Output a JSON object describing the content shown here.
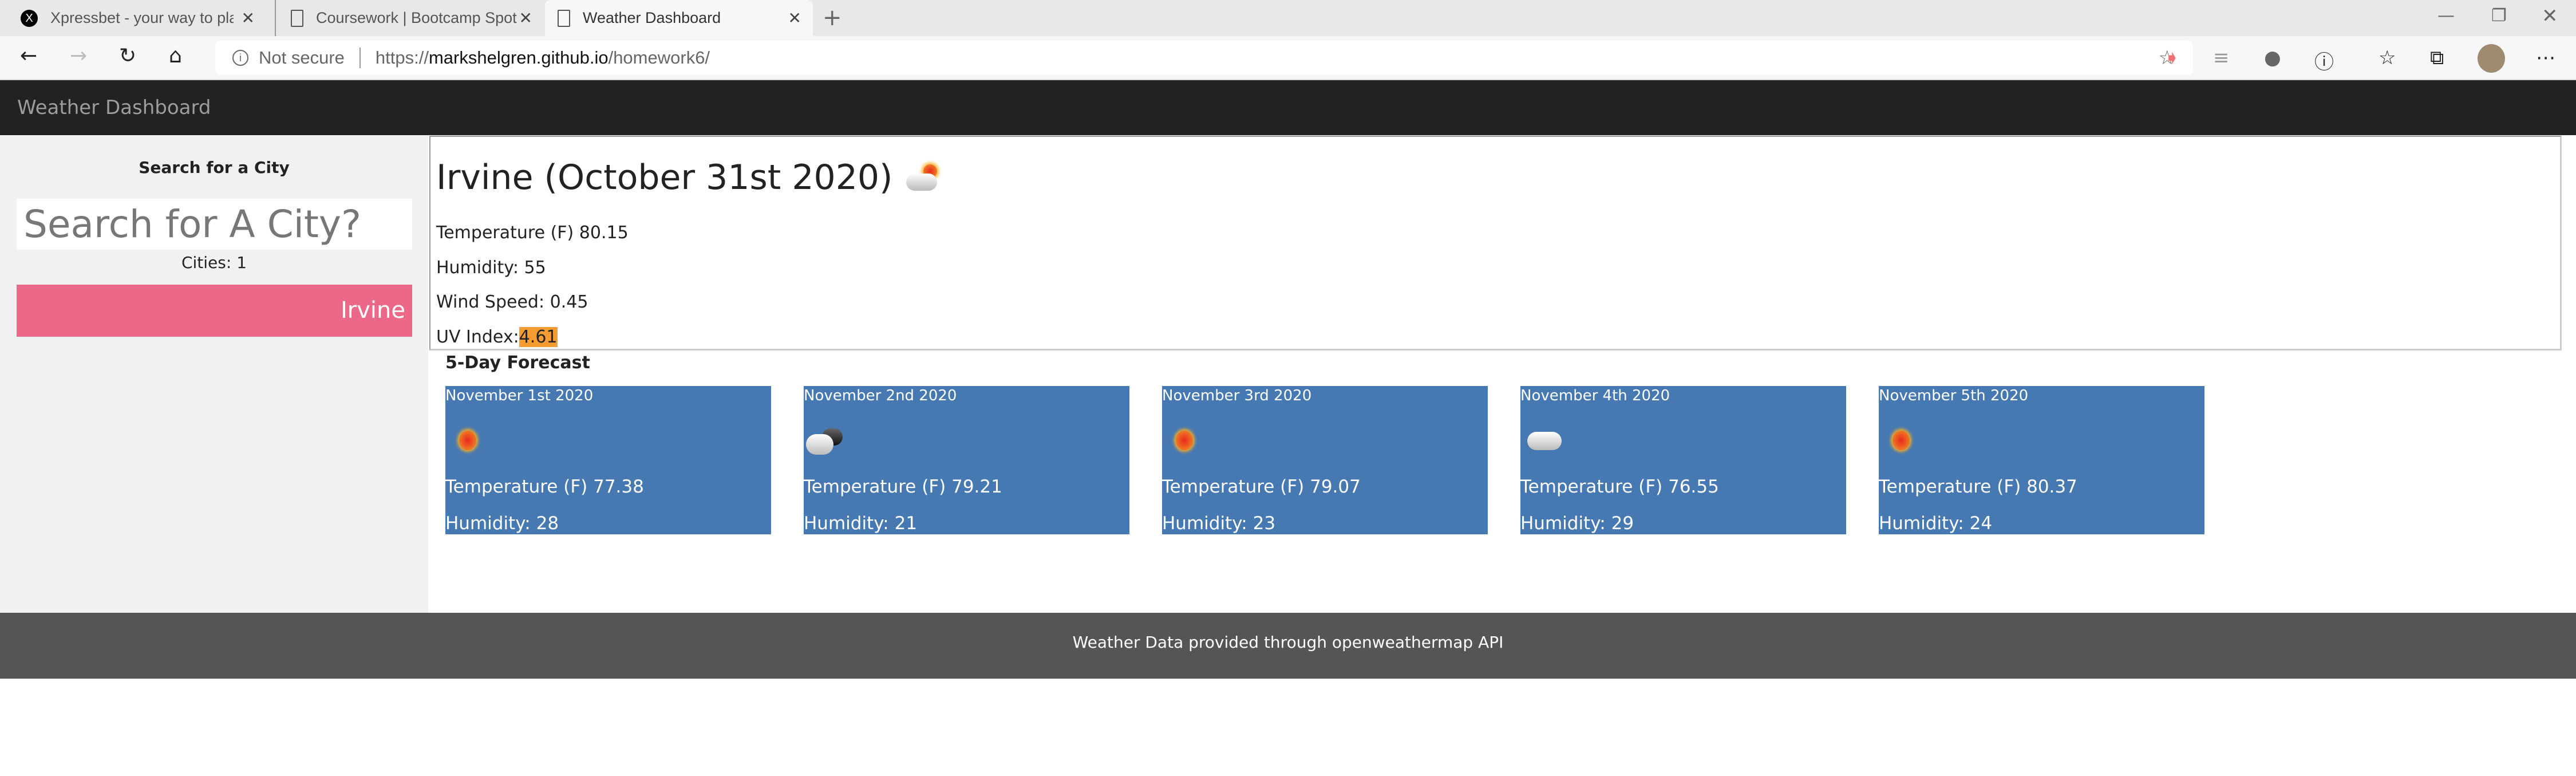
{
  "browser": {
    "tabs": [
      {
        "label": "Xpressbet - your way to play | (w",
        "icon": "xpressbet-icon"
      },
      {
        "label": "Coursework | Bootcamp Spot",
        "icon": "page-icon"
      },
      {
        "label": "Weather Dashboard",
        "icon": "page-icon",
        "active": true
      }
    ],
    "security": "Not secure",
    "url_prefix": "https://",
    "url_host": "markshelgren.github.io",
    "url_path": "/homework6/"
  },
  "nav": {
    "brand": "Weather Dashboard"
  },
  "sidebar": {
    "heading": "Search for a City",
    "search_placeholder": "Search for A City?",
    "cities_count": "Cities: 1",
    "cities": [
      "Irvine"
    ]
  },
  "current": {
    "title": "Irvine (October 31st 2020)",
    "icon": "few-clouds-day-icon",
    "temperature": "Temperature (F) 80.15",
    "humidity": "Humidity: 55",
    "wind": "Wind Speed: 0.45",
    "uv_label": "UV Index:",
    "uv_value": "4.61",
    "uv_color": "#f49b32"
  },
  "forecast": {
    "heading": "5-Day Forecast",
    "days": [
      {
        "date": "November 1st 2020",
        "icon": "clear-sun-icon",
        "temp": "Temperature (F) 77.38",
        "humidity": "Humidity: 28"
      },
      {
        "date": "November 2nd 2020",
        "icon": "clouds-night-icon",
        "temp": "Temperature (F) 79.21",
        "humidity": "Humidity: 21"
      },
      {
        "date": "November 3rd 2020",
        "icon": "clear-sun-icon",
        "temp": "Temperature (F) 79.07",
        "humidity": "Humidity: 23"
      },
      {
        "date": "November 4th 2020",
        "icon": "cloud-icon",
        "temp": "Temperature (F) 76.55",
        "humidity": "Humidity: 29"
      },
      {
        "date": "November 5th 2020",
        "icon": "clear-sun-icon",
        "temp": "Temperature (F) 80.37",
        "humidity": "Humidity: 24"
      }
    ]
  },
  "footer": {
    "text": "Weather Data provided through openweathermap API"
  },
  "colors": {
    "nav": "#222222",
    "sidebar": "#f1f1f1",
    "city_button": "#ec6889",
    "forecast_card": "#4678b2",
    "footer": "#555555"
  }
}
